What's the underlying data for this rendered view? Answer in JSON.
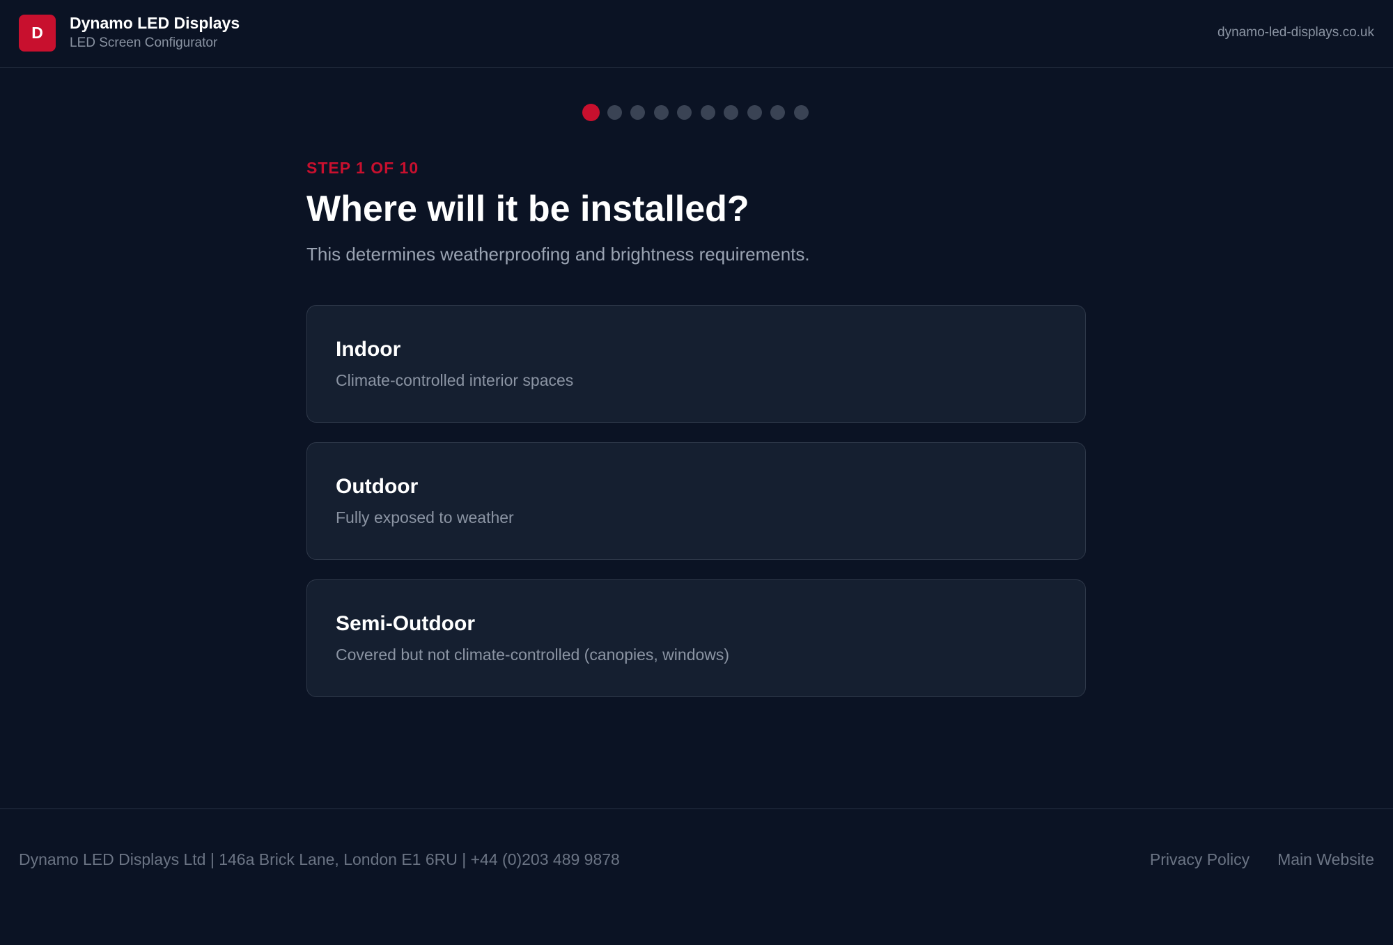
{
  "header": {
    "logo_letter": "D",
    "brand_name": "Dynamo LED Displays",
    "brand_subtitle": "LED Screen Configurator",
    "url": "dynamo-led-displays.co.uk"
  },
  "progress": {
    "current_step": 1,
    "total_steps": 10
  },
  "step": {
    "label": "STEP 1 OF 10",
    "title": "Where will it be installed?",
    "subtitle": "This determines weatherproofing and brightness requirements."
  },
  "options": [
    {
      "title": "Indoor",
      "description": "Climate-controlled interior spaces"
    },
    {
      "title": "Outdoor",
      "description": "Fully exposed to weather"
    },
    {
      "title": "Semi-Outdoor",
      "description": "Covered but not climate-controlled (canopies, windows)"
    }
  ],
  "footer": {
    "company_info": "Dynamo LED Displays Ltd | 146a Brick Lane, London E1 6RU | +44 (0)203 489 9878",
    "links": [
      "Privacy Policy",
      "Main Website"
    ]
  },
  "colors": {
    "background": "#0b1324",
    "accent": "#c8102e",
    "card": "#151f30",
    "inactive_dot": "#3a4354"
  }
}
